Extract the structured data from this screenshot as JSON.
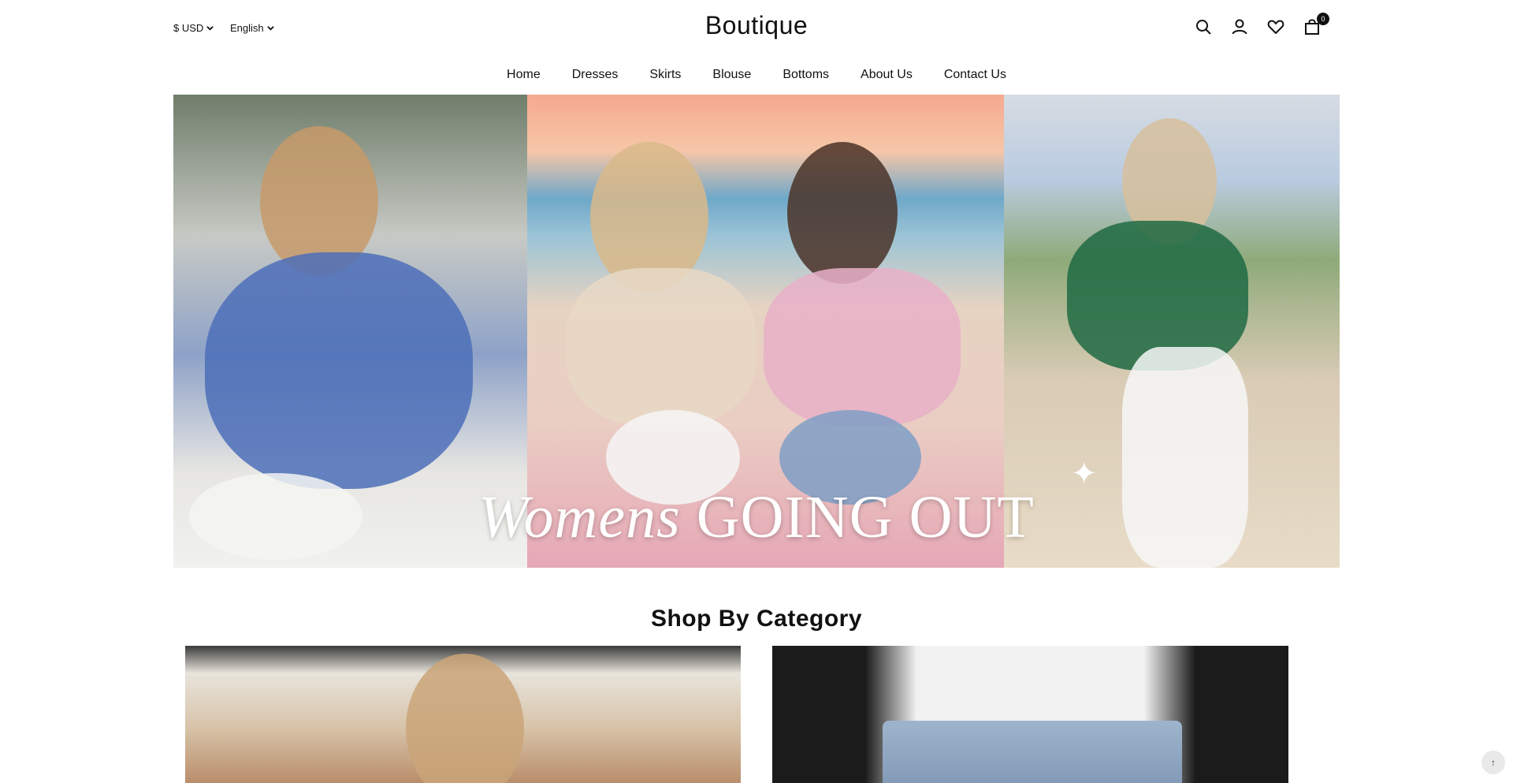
{
  "header": {
    "currency": "$ USD",
    "language": "English",
    "logo": "Boutique",
    "icons": [
      "search-icon",
      "account-icon",
      "wishlist-icon",
      "cart-icon"
    ],
    "cart_count": "0"
  },
  "nav": {
    "items": [
      "Home",
      "Dresses",
      "Skirts",
      "Blouse",
      "Bottoms",
      "About Us",
      "Contact Us"
    ]
  },
  "hero": {
    "banner_script": "Womens",
    "banner_caps": "GOING OUT"
  },
  "section": {
    "title": "Shop By Category"
  },
  "colors": {
    "text": "#111111",
    "background": "#ffffff",
    "badge": "#111111"
  }
}
